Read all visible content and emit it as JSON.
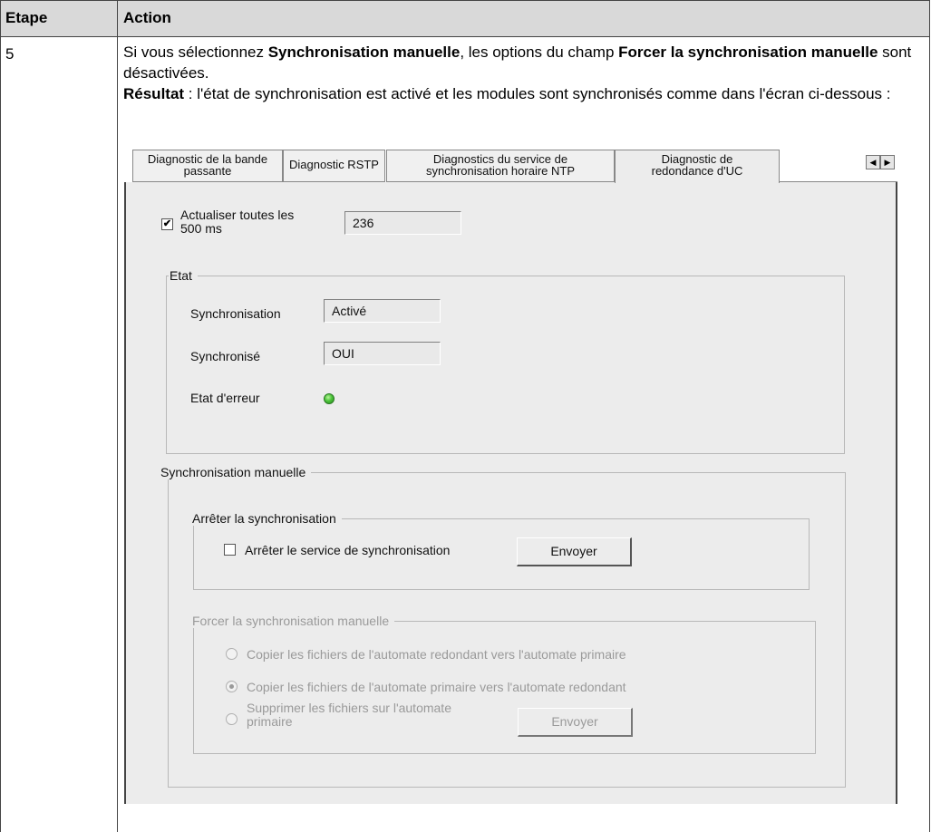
{
  "table": {
    "headers": [
      "Etape",
      "Action"
    ],
    "step": "5"
  },
  "action": {
    "line1_a": "Si vous sélectionnez ",
    "line1_b": "Synchronisation manuelle",
    "line1_c": ", les options du champ ",
    "line1_d": "Forcer la synchronisation manuelle",
    "line1_e": " sont désactivées.",
    "result_label": "Résultat",
    "result_text": " : l'état de synchronisation est activé et les modules sont synchronisés comme dans l'écran ci-dessous :"
  },
  "dialog": {
    "tabs": [
      {
        "line1": "Diagnostic de la bande",
        "line2": "passante"
      },
      {
        "line1": "Diagnostic RSTP",
        "line2": ""
      },
      {
        "line1": "Diagnostics du service de",
        "line2": "synchronisation horaire NTP"
      },
      {
        "line1": "Diagnostic de",
        "line2": "redondance d'UC"
      }
    ],
    "refresh": {
      "checked": true,
      "label_line1": "Actualiser toutes les",
      "label_line2": "500 ms",
      "value": "236"
    },
    "state_group": {
      "title": "Etat",
      "sync_label": "Synchronisation",
      "sync_value": "Activé",
      "synced_label": "Synchronisé",
      "synced_value": "OUI",
      "error_label": "Etat d'erreur",
      "error_led_color": "#4cc43a"
    },
    "manual_group": {
      "title": "Synchronisation manuelle",
      "stop_group": {
        "title": "Arrêter la synchronisation",
        "checkbox_label": "Arrêter le service de synchronisation",
        "checked": false,
        "send_label": "Envoyer"
      },
      "force_group": {
        "title": "Forcer la synchronisation manuelle",
        "option1": "Copier les fichiers de l'automate redondant vers l'automate primaire",
        "option2": "Copier les fichiers de l'automate primaire vers l'automate redondant",
        "option3_line1": "Supprimer les fichiers sur l'automate",
        "option3_line2": "primaire",
        "selected_option": 2,
        "send_label": "Envoyer"
      }
    }
  }
}
